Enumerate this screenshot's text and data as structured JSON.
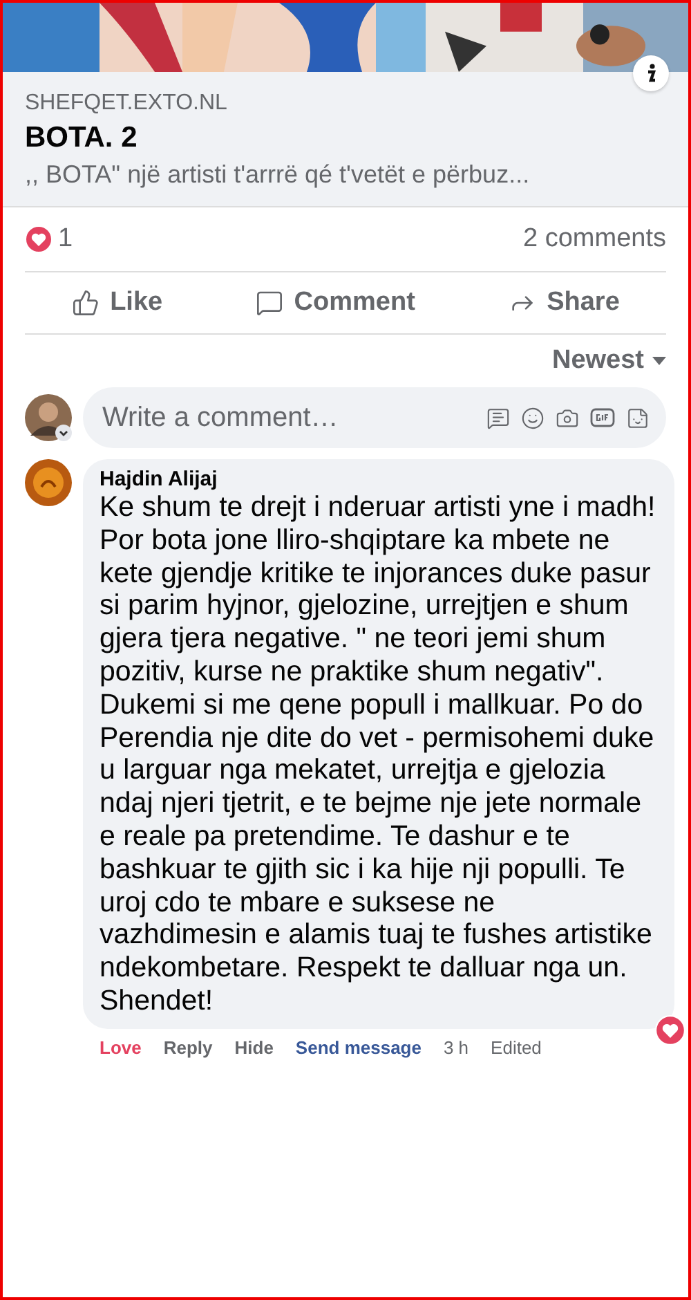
{
  "link_preview": {
    "kind": "picture",
    "domain": "SHEFQET.EXTO.NL",
    "title": "BOTA. 2",
    "description": ",, BOTA\" një artisti t'arrrë qé t'vetët e përbuz..."
  },
  "stats": {
    "reactions": "1",
    "comments": "2 comments"
  },
  "actions": [
    {
      "label": "Like",
      "kind": "like"
    },
    {
      "label": "Comment",
      "kind": "comment"
    },
    {
      "label": "Share",
      "kind": "share"
    }
  ],
  "sort": {
    "label": "Newest"
  },
  "composer": {
    "placeholder": "Write a comment…"
  },
  "comments": [
    {
      "author": "Hajdin Alijaj",
      "text": "Ke shum te drejt i nderuar artisti yne i madh! Por bota jone lliro-shqiptare ka mbete ne kete gjendje kritike te injorances duke pasur si parim hyjnor, gjelozine, urrejtjen e shum gjera tjera negative. \" ne teori jemi shum pozitiv, kurse ne praktike shum negativ\". Dukemi si me qene popull i mallkuar. Po do Perendia nje dite do vet - permisohemi duke u larguar nga mekatet, urrejtja e gjelozia ndaj njeri tjetrit, e te bejme nje jete normale e reale pa pretendime. Te dashur e te bashkuar te gjith sic i ka hije nji populli. Te uroj cdo te mbare e suksese ne vazhdimesin e alamis tuaj te fushes artistike ndekombetare. Respekt te dalluar nga un. Shendet!",
      "links": [
        {
          "label": "Love",
          "kind": "reaction"
        },
        {
          "label": "Reply",
          "kind": "action"
        },
        {
          "label": "Hide",
          "kind": "action"
        },
        {
          "label": "Send message",
          "kind": "link"
        },
        {
          "label": "3 h",
          "kind": "meta"
        },
        {
          "label": "Edited",
          "kind": "meta"
        }
      ]
    }
  ]
}
